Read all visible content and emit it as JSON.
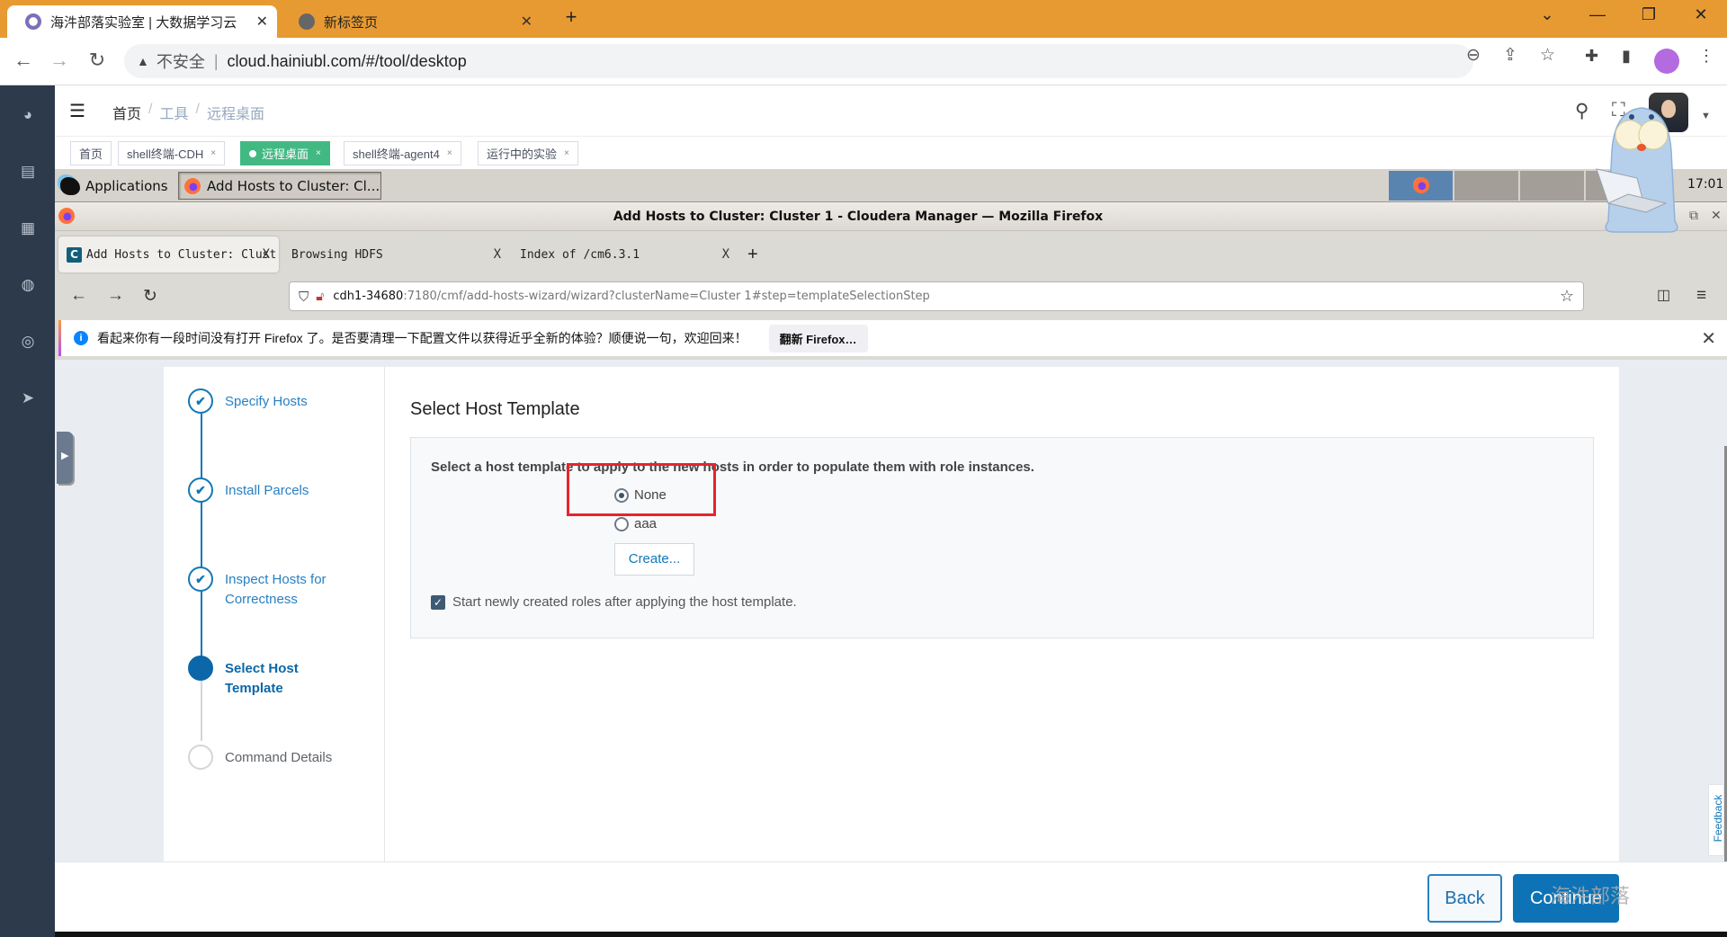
{
  "chrome": {
    "tabs": [
      {
        "title": "海汼部落实验室 | 大数据学习云",
        "active": true
      },
      {
        "title": "新标签页",
        "active": false
      }
    ],
    "new_tab": "+",
    "window_controls": {
      "dropdown": "⌄",
      "minimize": "—",
      "restore": "❐",
      "close": "✕"
    },
    "nav": {
      "back": "←",
      "forward": "→",
      "reload": "↻"
    },
    "omnibox": {
      "warning_icon": "▲",
      "security_label": "不安全",
      "separator": "|",
      "url": "cloud.hainiubl.com/#/tool/desktop"
    },
    "icons": {
      "zoom": "⊖",
      "share": "⇪",
      "bookmark": "☆",
      "extensions": "✚",
      "sidepanel": "▮",
      "menu": "⋮"
    }
  },
  "app": {
    "sidebar_icons": [
      "dashboard-icon",
      "document-icon",
      "apps-icon",
      "globe-icon",
      "lifebuoy-icon",
      "send-icon"
    ],
    "sidebar_glyphs": [
      "◕",
      "▤",
      "▦",
      "◍",
      "◎",
      "➤"
    ],
    "hamburger": "☰",
    "breadcrumb": [
      {
        "label": "首页"
      },
      {
        "label": "工具"
      },
      {
        "label": "远程桌面"
      }
    ],
    "breadcrumb_separator": "/",
    "header_icons": {
      "search": "⚲",
      "fullscreen": "⛶",
      "caret": "▼"
    },
    "tags": [
      {
        "label": "首页",
        "closable": false,
        "active": false
      },
      {
        "label": "shell终端-CDH",
        "closable": true,
        "active": false
      },
      {
        "label": "远程桌面",
        "closable": true,
        "active": true
      },
      {
        "label": "shell终端-agent4",
        "closable": true,
        "active": false
      },
      {
        "label": "运行中的实验",
        "closable": true,
        "active": false
      }
    ],
    "tag_close": "×"
  },
  "desktop": {
    "applications_label": "Applications",
    "task_label": "Add Hosts to Cluster: Cl...",
    "clock": "17:01",
    "workspaces": 4,
    "active_workspace": 1
  },
  "firefox": {
    "window_title": "Add Hosts to Cluster: Cluster 1 - Cloudera Manager — Mozilla Firefox",
    "window_controls": {
      "restore": "⧉",
      "close": "✕"
    },
    "tabs": [
      {
        "title": "Add Hosts to Cluster: Clust",
        "favicon": "C",
        "active": true
      },
      {
        "title": "Browsing HDFS",
        "active": false
      },
      {
        "title": "Index of /cm6.3.1",
        "active": false
      }
    ],
    "tab_close": "X",
    "new_tab": "+",
    "nav": {
      "back": "←",
      "forward": "→",
      "reload": "↻"
    },
    "url": {
      "host": "cdh1-34680",
      "rest": ":7180/cmf/add-hosts-wizard/wizard?clusterName=Cluster 1#step=templateSelectionStep"
    },
    "url_icons": {
      "shield": "⛉",
      "lock": "🔓︎",
      "star": "☆",
      "pocket": "◫",
      "menu": "≡"
    },
    "notification": {
      "info_icon": "i",
      "message": "看起来你有一段时间没有打开 Firefox 了。是否要清理一下配置文件以获得近乎全新的体验？顺便说一句，欢迎回来！",
      "button": "翻新 Firefox…",
      "close": "✕"
    }
  },
  "wizard": {
    "steps": [
      {
        "label": "Specify Hosts",
        "status": "done"
      },
      {
        "label": "Install Parcels",
        "status": "done"
      },
      {
        "label": "Inspect Hosts for Correctness",
        "status": "done"
      },
      {
        "label": "Select Host Template",
        "status": "current"
      },
      {
        "label": "Command Details",
        "status": "pending"
      }
    ],
    "check_glyph": "✔",
    "title": "Select Host Template",
    "instruction": "Select a host template to apply to the new hosts in order to populate them with role instances.",
    "options": [
      {
        "label": "None",
        "selected": true
      },
      {
        "label": "aaa",
        "selected": false
      }
    ],
    "create_button": "Create...",
    "start_roles": {
      "label": "Start newly created roles after applying the host template.",
      "checked": true,
      "glyph": "✓"
    },
    "feedback_label": "Feedback",
    "back_button": "Back",
    "continue_button": "Continue",
    "watermark": "海汼部落"
  },
  "colors": {
    "chrome_accent": "#e89a32",
    "sidebar_bg": "#2d3a4b",
    "active_tag": "#42b983",
    "cloudera_blue": "#0d73b6",
    "highlight_red": "#e8232d"
  }
}
